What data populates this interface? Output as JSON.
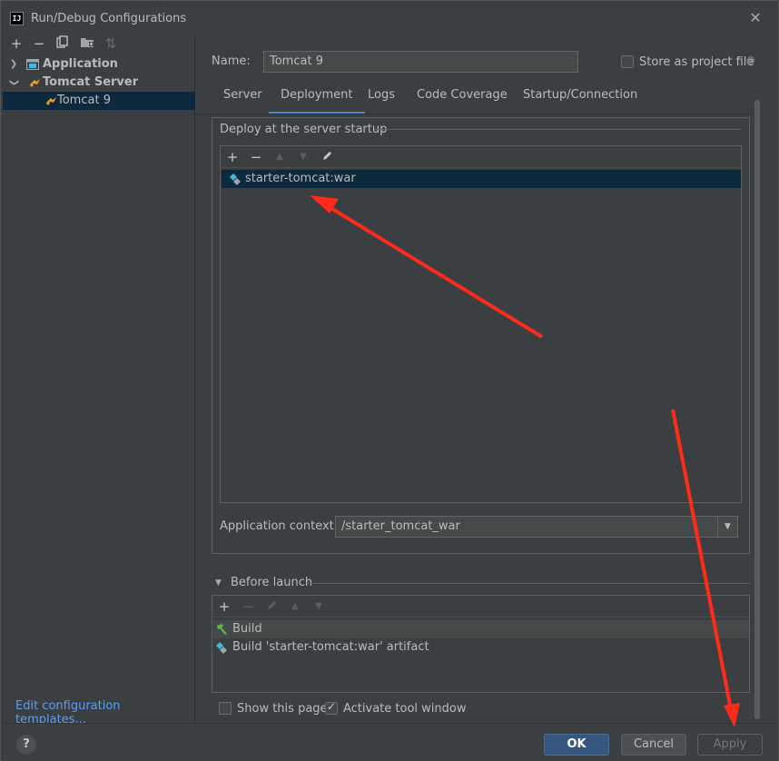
{
  "window": {
    "title": "Run/Debug Configurations",
    "app_icon_text": "IJ"
  },
  "left_toolbar": {
    "add": "+",
    "remove": "−",
    "copy": "⧉",
    "folder": "▶",
    "sort": "⇅"
  },
  "tree": [
    {
      "label": "Application",
      "expanded": false
    },
    {
      "label": "Tomcat Server",
      "expanded": true
    },
    {
      "label": "Tomcat 9",
      "selected": true
    }
  ],
  "edit_templates_link": "Edit configuration templates...",
  "name_field": {
    "label": "Name:",
    "value": "Tomcat 9"
  },
  "store_as_project_file": {
    "label": "Store as project file",
    "checked": false
  },
  "tabs": [
    {
      "label": "Server",
      "active": false
    },
    {
      "label": "Deployment",
      "active": true
    },
    {
      "label": "Logs",
      "active": false
    },
    {
      "label": "Code Coverage",
      "active": false
    },
    {
      "label": "Startup/Connection",
      "active": false
    }
  ],
  "deploy": {
    "group_title": "Deploy at the server startup",
    "items": [
      "starter-tomcat:war"
    ],
    "app_context_label": "Application context:",
    "app_context_value": "/starter_tomcat_war"
  },
  "before_launch": {
    "title": "Before launch",
    "items": [
      "Build",
      "Build 'starter-tomcat:war' artifact"
    ]
  },
  "show_this_page": {
    "label": "Show this page",
    "checked": false
  },
  "activate_tool_window": {
    "label": "Activate tool window",
    "checked": true
  },
  "buttons": {
    "ok": "OK",
    "cancel": "Cancel",
    "apply": "Apply",
    "help": "?"
  },
  "colors": {
    "accent": "#4a88c7",
    "selection": "#0d293e",
    "link": "#589df6",
    "primary_button": "#365880",
    "annotation_arrow": "#ff2a1a"
  },
  "icons": [
    "run-config-icon",
    "tomcat-icon",
    "artifact-icon",
    "hammer-icon",
    "gear-icon",
    "pencil-icon"
  ]
}
